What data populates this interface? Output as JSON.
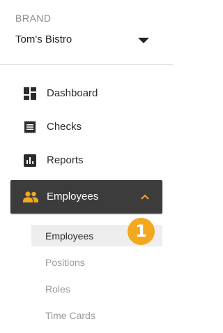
{
  "brand": {
    "label": "BRAND",
    "selected": "Tom's Bistro"
  },
  "nav": {
    "items": [
      {
        "label": "Dashboard",
        "icon": "dashboard-icon"
      },
      {
        "label": "Checks",
        "icon": "checks-icon"
      },
      {
        "label": "Reports",
        "icon": "reports-icon"
      },
      {
        "label": "Employees",
        "icon": "people-icon",
        "active": true,
        "expanded": true
      }
    ],
    "employees_sub": [
      {
        "label": "Employees",
        "selected": true
      },
      {
        "label": "Positions"
      },
      {
        "label": "Roles"
      },
      {
        "label": "Time Cards"
      }
    ]
  },
  "annotation": {
    "badge": "1"
  },
  "colors": {
    "active_bg": "#3c3c3c",
    "accent": "#f3a81f",
    "sub_selected_bg": "#eeeeee"
  }
}
